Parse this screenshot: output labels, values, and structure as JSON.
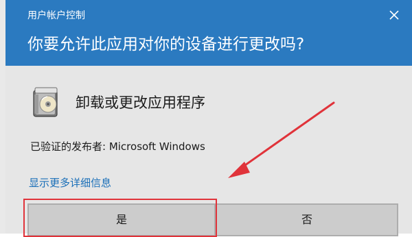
{
  "dialog": {
    "title": "用户帐户控制",
    "question": "你要允许此应用对你的设备进行更改吗?",
    "app_name": "卸载或更改应用程序",
    "publisher": "已验证的发布者: Microsoft Windows",
    "more_info_link": "显示更多详细信息",
    "buttons": {
      "yes": "是",
      "no": "否"
    }
  },
  "icons": {
    "close": "close-icon",
    "app": "programs-installer-icon"
  },
  "colors": {
    "header_bg": "#2b7ac0",
    "body_bg": "#e6e6e6",
    "button_bg": "#cccccc",
    "link": "#1a6fb8",
    "annotation": "#e0333a"
  }
}
